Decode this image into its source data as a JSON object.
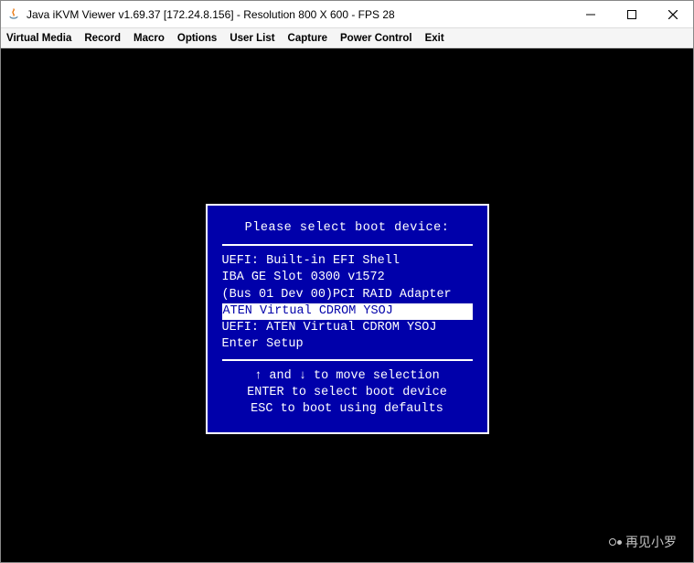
{
  "window": {
    "title": "Java iKVM Viewer v1.69.37 [172.24.8.156]  - Resolution 800 X 600 - FPS 28"
  },
  "menubar": {
    "items": [
      "Virtual Media",
      "Record",
      "Macro",
      "Options",
      "User List",
      "Capture",
      "Power Control",
      "Exit"
    ]
  },
  "bios": {
    "title": "Please select boot device:",
    "options": [
      "UEFI: Built-in EFI Shell",
      "IBA GE Slot 0300 v1572",
      "(Bus 01 Dev 00)PCI RAID Adapter",
      "ATEN Virtual CDROM YSOJ",
      "UEFI: ATEN Virtual CDROM YSOJ",
      "Enter Setup"
    ],
    "selected_index": 3,
    "help": [
      "↑ and ↓ to move selection",
      "ENTER to select boot device",
      "ESC to boot using defaults"
    ]
  },
  "watermark": {
    "text": "再见小罗"
  }
}
